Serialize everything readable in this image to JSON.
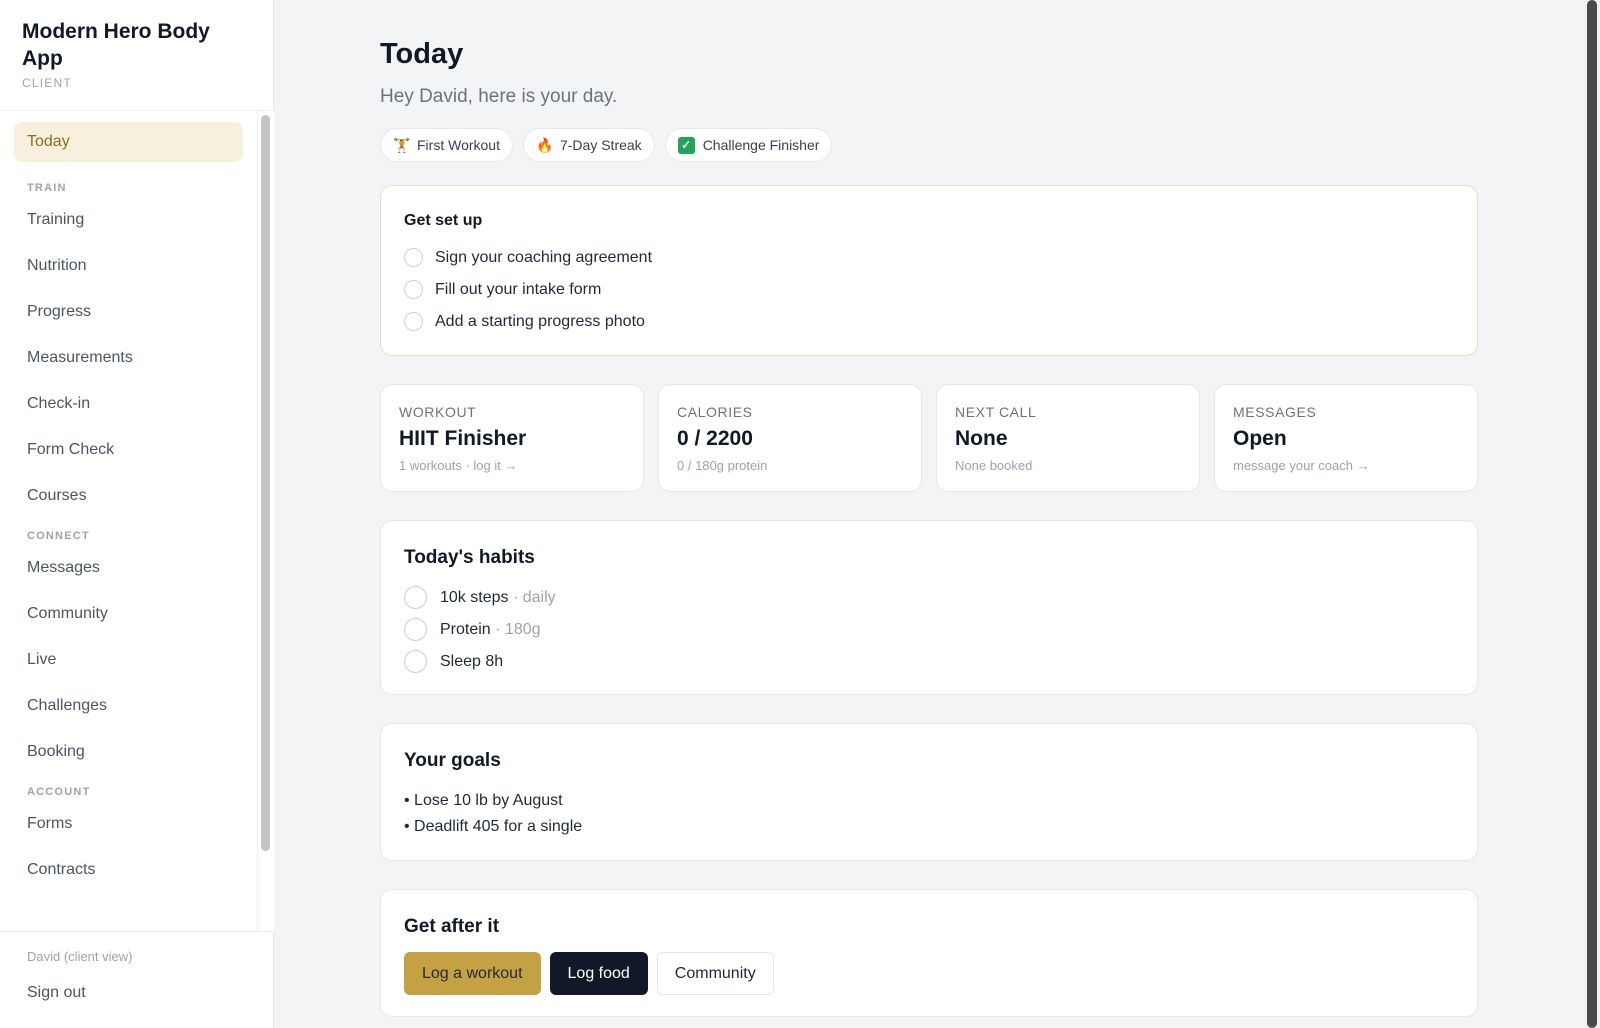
{
  "brand": {
    "title": "Modern Hero Body App",
    "subtitle": "CLIENT"
  },
  "sidebar": {
    "today": "Today",
    "sections": {
      "train": "TRAIN",
      "connect": "CONNECT",
      "account": "ACCOUNT"
    },
    "train_items": [
      "Training",
      "Nutrition",
      "Progress",
      "Measurements",
      "Check-in",
      "Form Check",
      "Courses"
    ],
    "connect_items": [
      "Messages",
      "Community",
      "Live",
      "Challenges",
      "Booking"
    ],
    "account_items": [
      "Forms",
      "Contracts"
    ],
    "user": "David (client view)",
    "sign_out": "Sign out"
  },
  "header": {
    "title": "Today",
    "subtitle": "Hey David, here is your day."
  },
  "badges": [
    {
      "icon": "trophy-icon",
      "glyph": "🏋",
      "label": "First Workout"
    },
    {
      "icon": "fire-icon",
      "glyph": "🔥",
      "label": "7-Day Streak"
    },
    {
      "icon": "check-icon",
      "glyph": "✓",
      "label": "Challenge Finisher"
    }
  ],
  "setup": {
    "title": "Get set up",
    "items": [
      "Sign your coaching agreement",
      "Fill out your intake form",
      "Add a starting progress photo"
    ]
  },
  "stats": [
    {
      "label": "WORKOUT",
      "value": "HIIT Finisher",
      "hint": "1 workouts · log it →"
    },
    {
      "label": "CALORIES",
      "value": "0 / 2200",
      "hint": "0 / 180g protein"
    },
    {
      "label": "NEXT CALL",
      "value": "None",
      "hint": "None booked"
    },
    {
      "label": "MESSAGES",
      "value": "Open",
      "hint": "message your coach →"
    }
  ],
  "habits": {
    "title": "Today's habits",
    "items": [
      {
        "name": "10k steps",
        "meta": "· daily"
      },
      {
        "name": "Protein",
        "meta": "· 180g"
      },
      {
        "name": "Sleep 8h",
        "meta": ""
      }
    ]
  },
  "goals": {
    "title": "Your goals",
    "items": [
      "• Lose 10 lb by August",
      "• Deadlift 405 for a single"
    ]
  },
  "actions": {
    "title": "Get after it",
    "log_workout": "Log a workout",
    "log_food": "Log food",
    "community": "Community"
  },
  "colors": {
    "accent": "#c4a143",
    "active_bg": "#f7f0dc",
    "dark": "#111827"
  }
}
